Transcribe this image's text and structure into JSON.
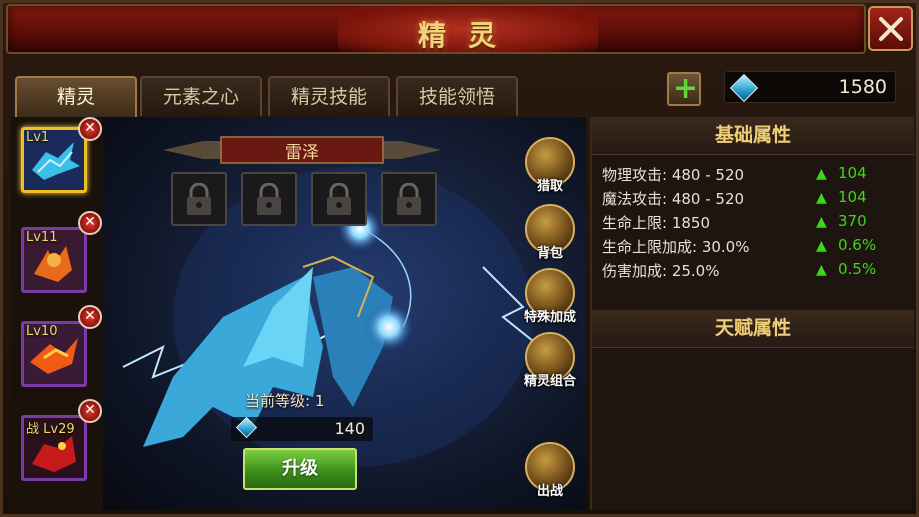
{
  "window": {
    "title": "精灵"
  },
  "tabs": [
    {
      "label": "精灵",
      "active": true
    },
    {
      "label": "元素之心",
      "active": false
    },
    {
      "label": "精灵技能",
      "active": false
    },
    {
      "label": "技能领悟",
      "active": false
    }
  ],
  "currency": {
    "icon": "crystal-icon",
    "amount": "1580"
  },
  "sprites": [
    {
      "level": "Lv1",
      "selected": true
    },
    {
      "level": "Lv11",
      "selected": false
    },
    {
      "level": "Lv10",
      "selected": false
    },
    {
      "level": "战 Lv29",
      "selected": false
    }
  ],
  "stage": {
    "sprite_name": "雷泽",
    "lock_slots": 4,
    "current_level": "当前等级: 1",
    "cost": "140",
    "upgrade_label": "升级"
  },
  "side_buttons": {
    "hunt": "猎取",
    "bag": "背包",
    "special_bonus": "特殊加成",
    "sprite_combo": "精灵组合",
    "deploy": "出战"
  },
  "basic_attrs": {
    "title": "基础属性",
    "rows": [
      {
        "name": "物理攻击: 480 - 520",
        "inc": "104"
      },
      {
        "name": "魔法攻击: 480 - 520",
        "inc": "104"
      },
      {
        "name": "生命上限: 1850",
        "inc": "370"
      },
      {
        "name": "生命上限加成: 30.0%",
        "inc": "0.6%"
      },
      {
        "name": "伤害加成: 25.0%",
        "inc": "0.5%"
      }
    ]
  },
  "talent_attrs": {
    "title": "天赋属性"
  },
  "colors": {
    "accent_gold": "#f0cf78",
    "increase_green": "#3ad81a",
    "upgrade_green": "#5cb830"
  }
}
